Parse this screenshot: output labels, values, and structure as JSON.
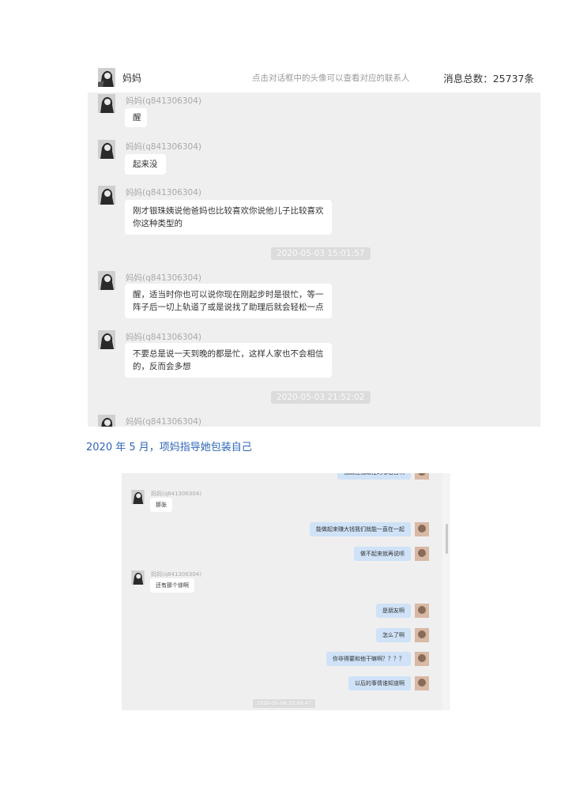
{
  "shot1": {
    "header": {
      "contact_name": "妈妈",
      "hint": "点击对话框中的头像可以查看对应的联系人",
      "message_total": "消息总数：25737条"
    },
    "messages": [
      {
        "sender": "妈妈(q841306304)",
        "lines": [
          "醒"
        ]
      },
      {
        "sender": "妈妈(q841306304)",
        "lines": [
          "起来没"
        ]
      },
      {
        "sender": "妈妈(q841306304)",
        "lines": [
          "刚才银珠姨说他爸妈也比较喜欢你说他儿子比较喜欢",
          "你这种类型的"
        ]
      },
      {
        "sender": "妈妈(q841306304)",
        "lines": [
          "醒，适当时你也可以说你现在刚起步时是很忙，等一",
          "阵子后一切上轨道了或是说找了助理后就会轻松一点"
        ]
      },
      {
        "sender": "妈妈(q841306304)",
        "lines": [
          "不要总是说一天到晚的都是忙，这样人家也不会相信",
          "的，反而会多想"
        ]
      },
      {
        "sender": "妈妈(q841306304)",
        "lines": []
      }
    ],
    "timestamps": [
      "2020-05-03 15:01:57",
      "2020-05-03 21:52:02"
    ]
  },
  "caption": "2020 年 5 月，项妈指导她包装自己",
  "shot2": {
    "top_partial_bubble": "我就住我现在的哪宿舍啊",
    "items": [
      {
        "side": "left",
        "sender": "妈妈(q841306304)",
        "text": "那张"
      },
      {
        "side": "right",
        "text": "能做起来赚大钱我们就能一直在一起"
      },
      {
        "side": "right",
        "text": "做不起来就再说呗"
      },
      {
        "side": "left",
        "sender": "妈妈(q841306304)",
        "text": "还有那个徐啊"
      },
      {
        "side": "right",
        "text": "是朋友啊"
      },
      {
        "side": "right",
        "text": "怎么了啊"
      },
      {
        "side": "right",
        "text": "你非得要和他干嘛啊？？？？"
      },
      {
        "side": "right",
        "text": "以后的事情谁知道啊"
      }
    ],
    "timestamp": "2020-05-06 22:09:47"
  },
  "colors": {
    "chat_bg": "#efefef",
    "self_bubble": "#cfe2f7",
    "caption": "#2f65b7"
  }
}
